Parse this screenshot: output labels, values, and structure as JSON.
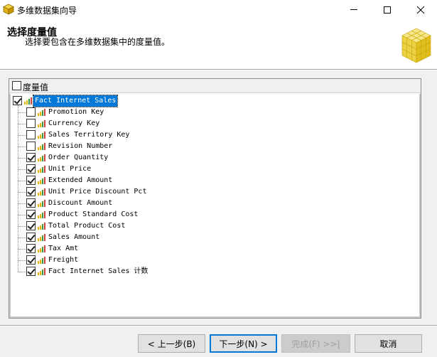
{
  "window": {
    "title": "多维数据集向导",
    "icon": "cube-app-icon",
    "controls": [
      "minimize",
      "maximize",
      "close"
    ]
  },
  "header": {
    "title": "选择度量值",
    "subtitle": "选择要包含在多维数据集中的度量值。"
  },
  "panel": {
    "header_label": "度量值",
    "header_checked": false,
    "root": {
      "label": "Fact Internet Sales",
      "checked": true,
      "selected": true
    },
    "items": [
      {
        "label": "Promotion Key",
        "checked": false
      },
      {
        "label": "Currency Key",
        "checked": false
      },
      {
        "label": "Sales Territory Key",
        "checked": false
      },
      {
        "label": "Revision Number",
        "checked": false
      },
      {
        "label": "Order Quantity",
        "checked": true
      },
      {
        "label": "Unit Price",
        "checked": true
      },
      {
        "label": "Extended Amount",
        "checked": true
      },
      {
        "label": "Unit Price Discount Pct",
        "checked": true
      },
      {
        "label": "Discount Amount",
        "checked": true
      },
      {
        "label": "Product Standard Cost",
        "checked": true
      },
      {
        "label": "Total Product Cost",
        "checked": true
      },
      {
        "label": "Sales Amount",
        "checked": true
      },
      {
        "label": "Tax Amt",
        "checked": true
      },
      {
        "label": "Freight",
        "checked": true
      },
      {
        "label": "Fact Internet Sales 计数",
        "checked": true
      }
    ]
  },
  "buttons": {
    "back": "< 上一步(B)",
    "next": "下一步(N) >",
    "finish": "完成(F) >>|",
    "cancel": "取消"
  },
  "colors": {
    "selection": "#0078d7",
    "measure_icon_yellow": "#e8b400",
    "measure_icon_green": "#3a9a3a",
    "measure_icon_red": "#d04040"
  }
}
